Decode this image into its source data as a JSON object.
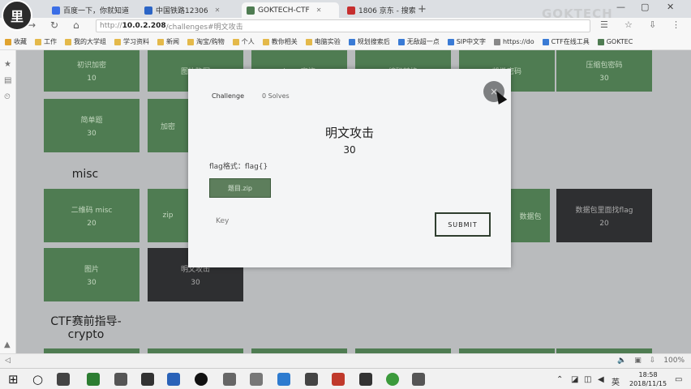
{
  "browser": {
    "avatar_text": "里",
    "tabs": [
      {
        "label": "百度一下，你就知道",
        "color": "#3b6ee6",
        "active": false
      },
      {
        "label": "中国铁路12306",
        "color": "#2c65c6",
        "active": false
      },
      {
        "label": "GOKTECH-CTF",
        "color": "#4f7c52",
        "active": true
      },
      {
        "label": "1806 京东 - 搜索",
        "color": "#c62f2f",
        "active": false
      }
    ],
    "new_tab": "+",
    "watermark": "GOKTECH",
    "url_prefix": "http://",
    "url_host": "10.0.2.208",
    "url_path": "/challenges#明文攻击",
    "nav_back": "←",
    "nav_forward": "→",
    "nav_reload": "↻",
    "nav_home": "⌂",
    "bookmarks": [
      "收藏",
      "工作",
      "我的大学组",
      "学习资料",
      "新闻",
      "淘宝/购物",
      "个人",
      "教你相关",
      "电脑实验",
      "规划搜索后",
      "无敌超一点",
      "SIP中文字",
      "https://do",
      "CTF在线工具",
      "GOKTEC"
    ]
  },
  "side_icons": [
    "★",
    "▤",
    "⏲"
  ],
  "page": {
    "section_misc": "misc",
    "section_crypto": "CTF赛前指导-\ncrypto",
    "top_cards": [
      {
        "name": "初识加密",
        "points": "10"
      },
      {
        "name": "图片隐写",
        "points": ""
      },
      {
        "name": "base家族",
        "points": ""
      },
      {
        "name": "编码转换",
        "points": ""
      },
      {
        "name": "凯撒密码",
        "points": ""
      },
      {
        "name": "压缩包密码",
        "points": "30"
      }
    ],
    "row2_cards": [
      {
        "name": "简单题",
        "points": "30"
      },
      {
        "name": "加密",
        "points": ""
      }
    ],
    "misc_cards": [
      {
        "name": "二维码 misc",
        "points": "20"
      },
      {
        "name": "zip",
        "points": ""
      },
      {
        "name": "数据包",
        "points": ""
      },
      {
        "name": "数据包里面找flag",
        "points": "20"
      }
    ],
    "misc_row2": [
      {
        "name": "图片",
        "points": "30"
      },
      {
        "name": "明文攻击",
        "points": "30"
      }
    ]
  },
  "modal": {
    "tab_challenge": "Challenge",
    "tab_solves": "0 Solves",
    "close": "×",
    "title": "明文攻击",
    "value": "30",
    "description": "flag格式：flag{}",
    "file_button": "题目.zip",
    "key_placeholder": "Key",
    "submit": "SUBMIT"
  },
  "statusbar": {
    "zoom": "100%"
  },
  "taskbar": {
    "start": "⊞",
    "search": "○",
    "time": "18:58",
    "date": "2018/11/15",
    "ime": "英"
  }
}
